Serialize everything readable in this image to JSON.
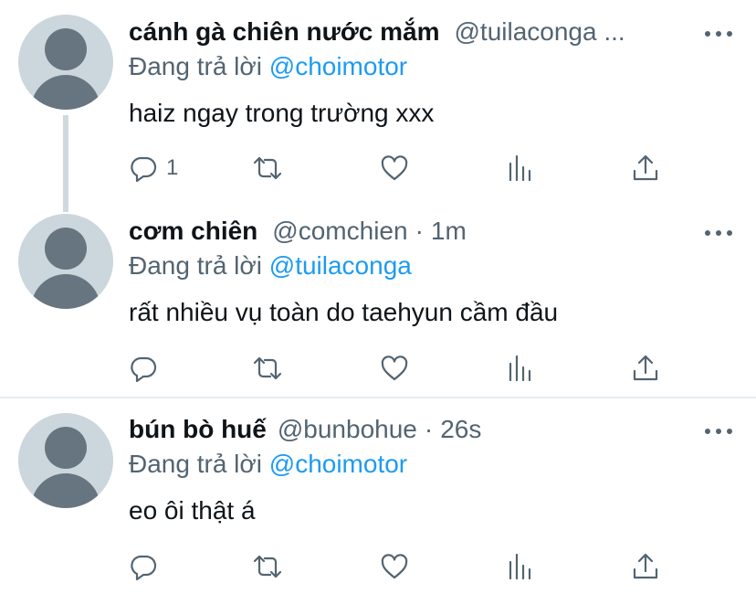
{
  "replies": [
    {
      "name": "cánh gà chiên nước mắm",
      "handle": "@tuilaconga ...",
      "time": "",
      "replying_prefix": "Đang trả lời ",
      "replying_to": "@choimotor",
      "text": "haiz ngay trong trường xxx",
      "reply_count": "1"
    },
    {
      "name": "cơm chiên",
      "handle": "@comchien",
      "time": "1m",
      "replying_prefix": "Đang trả lời ",
      "replying_to": "@tuilaconga",
      "text": "rất nhiều vụ toàn do taehyun cầm đầu",
      "reply_count": ""
    },
    {
      "name": "bún bò huế",
      "handle": "@bunbohue",
      "time": "26s",
      "replying_prefix": "Đang trả lời ",
      "replying_to": "@choimotor",
      "text": "eo ôi thật á",
      "reply_count": ""
    }
  ],
  "separator": "·",
  "colors": {
    "link": "#1d9bf0",
    "muted": "#536471",
    "avatar_bg": "#ccd6dd",
    "avatar_fg": "#66757f"
  },
  "icons": [
    "reply-icon",
    "retweet-icon",
    "like-icon",
    "views-icon",
    "share-icon",
    "more-icon"
  ]
}
